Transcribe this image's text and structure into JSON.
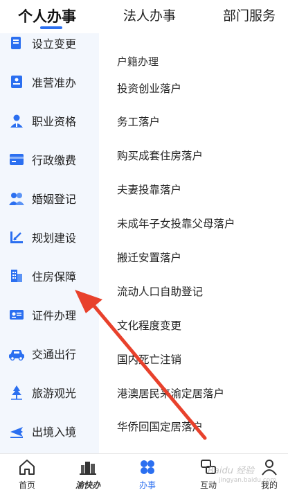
{
  "top_tabs": {
    "personal": "个人办事",
    "legal": "法人办事",
    "department": "部门服务"
  },
  "sidebar": {
    "items": [
      {
        "label": "设立变更",
        "icon": "registration-change-icon"
      },
      {
        "label": "准营准办",
        "icon": "business-permit-icon"
      },
      {
        "label": "职业资格",
        "icon": "professional-qualification-icon"
      },
      {
        "label": "行政缴费",
        "icon": "administrative-payment-icon"
      },
      {
        "label": "婚姻登记",
        "icon": "marriage-registration-icon"
      },
      {
        "label": "规划建设",
        "icon": "planning-construction-icon"
      },
      {
        "label": "住房保障",
        "icon": "housing-security-icon"
      },
      {
        "label": "证件办理",
        "icon": "id-card-icon"
      },
      {
        "label": "交通出行",
        "icon": "car-icon"
      },
      {
        "label": "旅游观光",
        "icon": "tree-icon"
      },
      {
        "label": "出境入境",
        "icon": "airplane-icon"
      }
    ]
  },
  "content": {
    "section_title": "户籍办理",
    "items": [
      "投资创业落户",
      "务工落户",
      "购买成套住房落户",
      "夫妻投靠落户",
      "未成年子女投靠父母落户",
      "搬迁安置落户",
      "流动人口自助登记",
      "文化程度变更",
      "国内死亡注销",
      "港澳居民来渝定居落户",
      "华侨回国定居落户"
    ]
  },
  "bottom_nav": {
    "home": "首页",
    "brand": "渝快办",
    "services": "办事",
    "interact": "互动",
    "mine": "我的"
  },
  "watermark": {
    "text": "Baidu 经验",
    "sub": "jingyan.baidu.com"
  },
  "colors": {
    "accent": "#2b6ff0",
    "sidebar_bg": "#f3f7fd",
    "arrow": "#e8412c"
  }
}
